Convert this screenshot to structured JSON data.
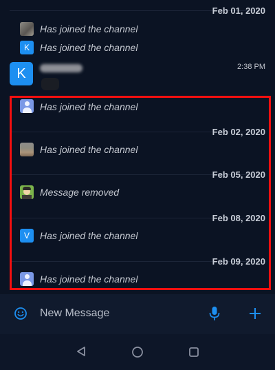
{
  "messages": {
    "date_1": "Feb 01, 2020",
    "join_1": "Has joined the channel",
    "join_2": "Has joined the channel",
    "k_avatar_letter": "K",
    "join_2_avatar_letter": "K",
    "time_1": "2:38 PM",
    "join_3": "Has joined the channel",
    "date_2": "Feb 02, 2020",
    "join_4": "Has joined the channel",
    "date_3": "Feb 05, 2020",
    "removed": "Message removed",
    "date_4": "Feb 08, 2020",
    "v_avatar_letter": "V",
    "join_5": "Has joined the channel",
    "date_5": "Feb 09, 2020",
    "join_6": "Has joined the channel"
  },
  "composer": {
    "placeholder": "New Message",
    "emoji_icon": "emoji-icon",
    "mic_icon": "mic-icon",
    "add_icon": "plus-icon"
  },
  "navbar": {
    "back_icon": "back-triangle-icon",
    "home_icon": "home-circle-icon",
    "recents_icon": "recents-square-icon"
  },
  "colors": {
    "background": "#0b1323",
    "accent": "#1d8ff1",
    "highlight": "#f40f0f"
  }
}
